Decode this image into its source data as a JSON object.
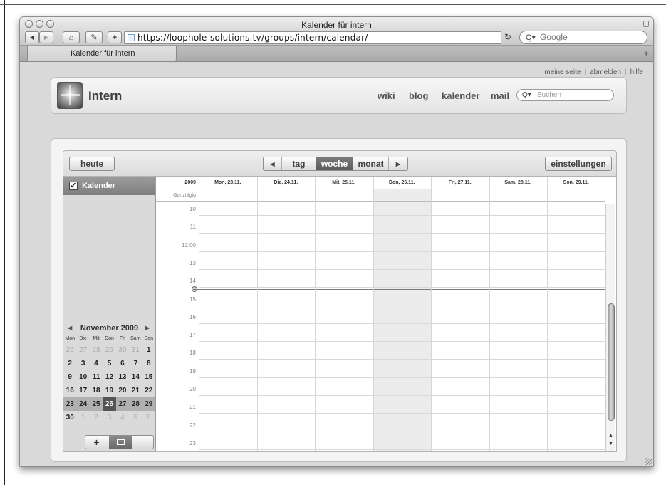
{
  "window": {
    "title": "Kalender für intern",
    "url": "https://loophole-solutions.tv/groups/intern/calendar/",
    "google_placeholder": "Google",
    "tab_title": "Kalender für intern",
    "reload_glyph": "↻",
    "add_tab_glyph": "+"
  },
  "toolbar": {
    "back_glyph": "◀",
    "forward_glyph": "▶",
    "home_glyph": "⌂",
    "edit_glyph": "✎",
    "add_glyph": "+"
  },
  "site": {
    "top_links": [
      "meine seite",
      "abmelden",
      "hilfe"
    ],
    "title": "Intern",
    "nav": [
      "wiki",
      "blog",
      "kalender",
      "mail"
    ],
    "search_placeholder": "Suchen"
  },
  "calendar_toolbar": {
    "today_label": "heute",
    "prev_glyph": "◀",
    "next_glyph": "▶",
    "views": [
      "tag",
      "woche",
      "monat"
    ],
    "active_view": "woche",
    "settings_label": "einstellungen"
  },
  "sidebar": {
    "calendar_label": "Kalender",
    "checked": true,
    "check_glyph": "✓",
    "add_glyph": "+"
  },
  "mini_calendar": {
    "month": "November 2009",
    "prev_glyph": "◀",
    "next_glyph": "▶",
    "day_names": [
      "Mon",
      "Die",
      "Mit",
      "Don",
      "Fri",
      "Sam",
      "Son"
    ],
    "weeks": [
      [
        "26",
        "27",
        "28",
        "29",
        "30",
        "31",
        "1"
      ],
      [
        "2",
        "3",
        "4",
        "5",
        "6",
        "7",
        "8"
      ],
      [
        "9",
        "10",
        "11",
        "12",
        "13",
        "14",
        "15"
      ],
      [
        "16",
        "17",
        "18",
        "19",
        "20",
        "21",
        "22"
      ],
      [
        "23",
        "24",
        "25",
        "26",
        "27",
        "28",
        "29"
      ],
      [
        "30",
        "1",
        "2",
        "3",
        "4",
        "5",
        "6"
      ]
    ],
    "today": "26"
  },
  "week_view": {
    "year": "2009",
    "all_day_label": "Ganztägig",
    "days": [
      "Mon, 23.11.",
      "Die, 24.11.",
      "Mit, 25.11.",
      "Don, 26.11.",
      "Fri, 27.11.",
      "Sam, 28.11.",
      "Son, 29.11."
    ],
    "hours": [
      "10",
      "11",
      "12:00",
      "13",
      "14",
      "15",
      "16",
      "17",
      "18",
      "19",
      "20",
      "21",
      "22",
      "23"
    ]
  }
}
